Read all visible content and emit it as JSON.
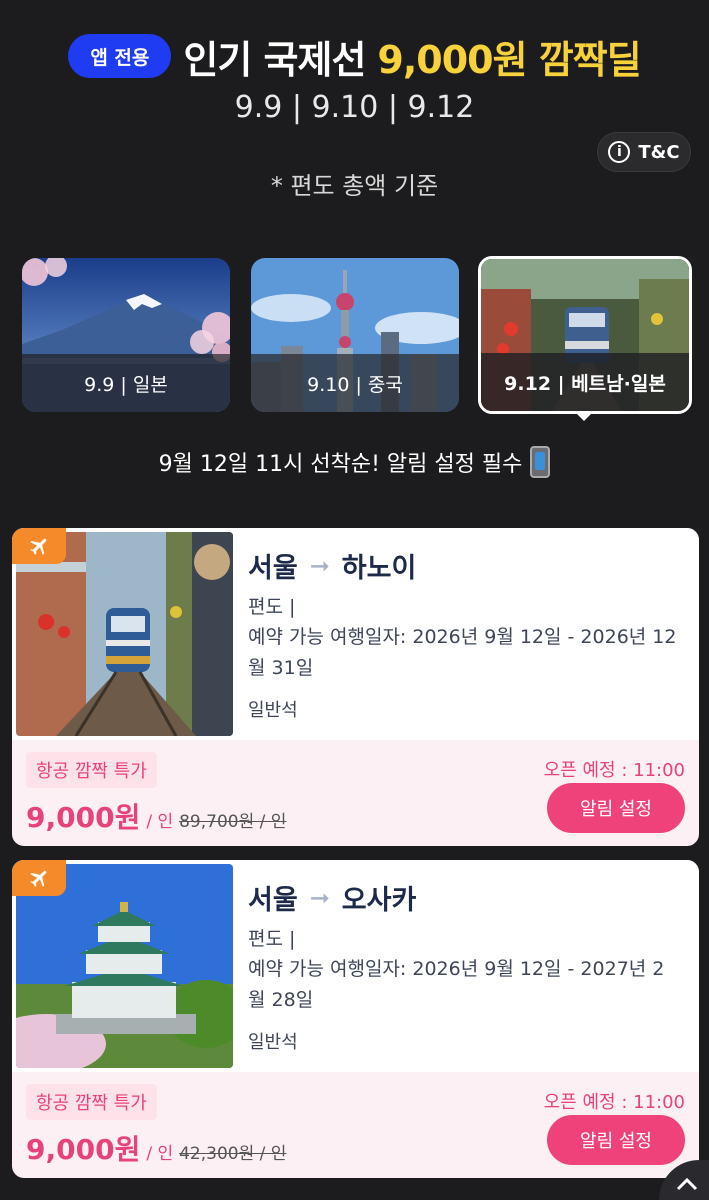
{
  "header": {
    "app_badge": "앱 전용",
    "title_main": "인기 국제선",
    "title_highlight": "9,000원 깜짝딜",
    "dates": "9.9 | 9.10 | 9.12",
    "tc_label": "T&C",
    "note": "* 편도 총액 기준"
  },
  "tabs": [
    {
      "label": "9.9 | 일본",
      "icon": "mount-fuji-scene"
    },
    {
      "label": "9.10 | 중국",
      "icon": "shanghai-tower-scene"
    },
    {
      "label": "9.12 | 베트남·일본",
      "icon": "hanoi-train-street-scene",
      "active": true
    }
  ],
  "notice": {
    "text": "9월 12일 11시 선착순! 알림 설정 필수",
    "icon": "mobile-phone-icon"
  },
  "deals": [
    {
      "origin": "서울",
      "destination": "하노이",
      "trip_type": "편도 |",
      "period": "예약 가능 여행일자:  2026년 9월 12일  - 2026년 12월 31일",
      "seat_class": "일반석",
      "promo_label": "항공 깜짝 특가",
      "price": "9,000원",
      "per": "/ 인",
      "original_price": "89,700원 / 인",
      "open_time": "오픈 예정 : 11:00",
      "button_label": "알림 설정",
      "image": "hanoi-train-street"
    },
    {
      "origin": "서울",
      "destination": "오사카",
      "trip_type": "편도 |",
      "period": "예약 가능 여행일자:  2026년 9월 12일  - 2027년 2월 28일",
      "seat_class": "일반석",
      "promo_label": "항공 깜짝 특가",
      "price": "9,000원",
      "per": "/ 인",
      "original_price": "42,300원 / 인",
      "open_time": "오픈 예정 : 11:00",
      "button_label": "알림 설정",
      "image": "osaka-castle"
    }
  ],
  "colors": {
    "background": "#1c1c1e",
    "app_badge": "#1f3cf2",
    "highlight": "#f7d23b",
    "accent_pink": "#f0427a",
    "flight_tag": "#f58a2a"
  }
}
